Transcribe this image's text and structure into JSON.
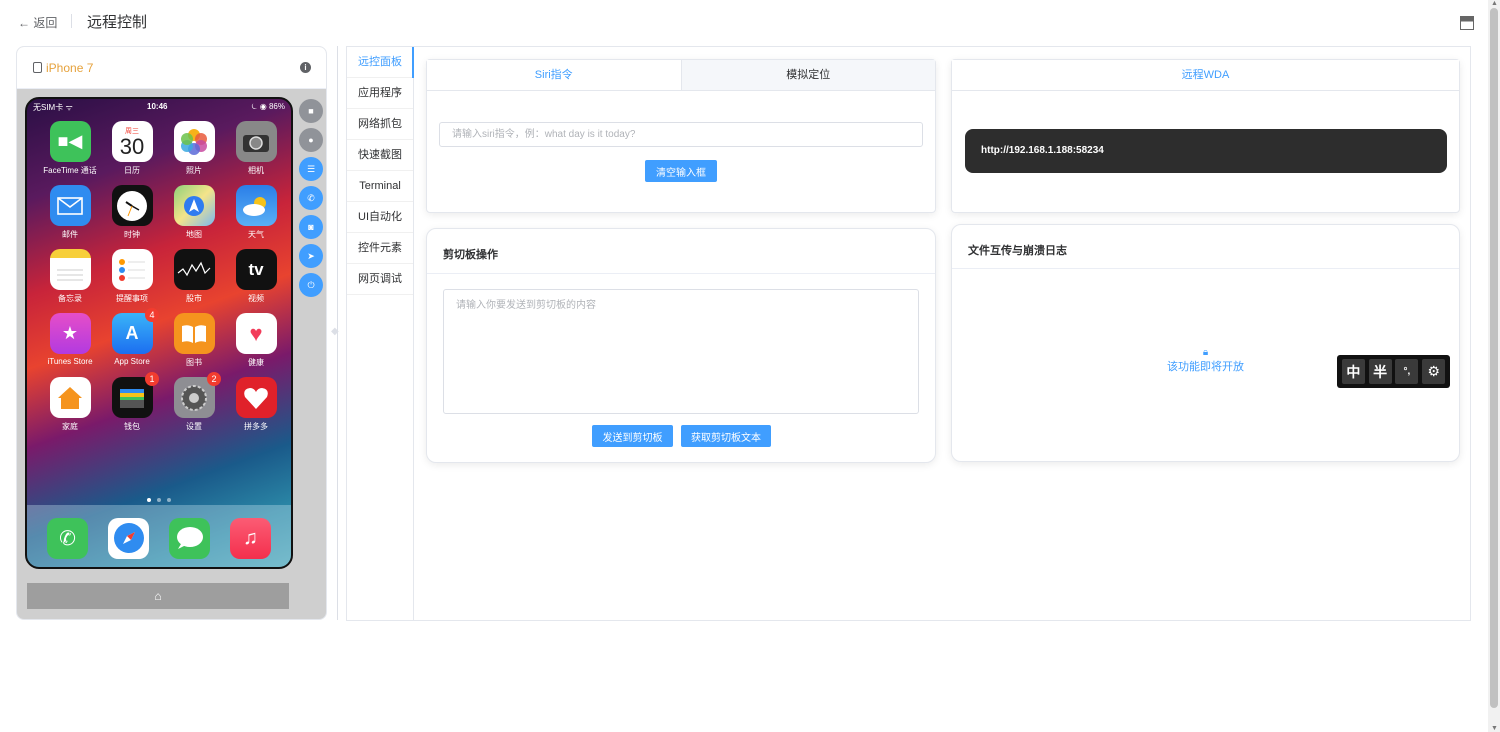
{
  "header": {
    "back_label": "← 返回",
    "title": "远程控制"
  },
  "device": {
    "name": "iPhone 7",
    "status": {
      "carrier": "无SIM卡 ᯤ",
      "time": "10:46",
      "battery": "⏾ ◉ 86%"
    },
    "apps": [
      {
        "label": "FaceTime 通话",
        "icon": "facetime-icon"
      },
      {
        "label": "日历",
        "icon": "calendar-icon",
        "day": "周三",
        "date": "30"
      },
      {
        "label": "照片",
        "icon": "photos-icon"
      },
      {
        "label": "相机",
        "icon": "camera-icon"
      },
      {
        "label": "邮件",
        "icon": "mail-icon"
      },
      {
        "label": "时钟",
        "icon": "clock-icon"
      },
      {
        "label": "地图",
        "icon": "maps-icon"
      },
      {
        "label": "天气",
        "icon": "weather-icon"
      },
      {
        "label": "备忘录",
        "icon": "notes-icon"
      },
      {
        "label": "提醒事项",
        "icon": "reminders-icon"
      },
      {
        "label": "股市",
        "icon": "stocks-icon"
      },
      {
        "label": "视频",
        "icon": "tv-icon",
        "glyph": "tv"
      },
      {
        "label": "iTunes Store",
        "icon": "itunes-icon"
      },
      {
        "label": "App Store",
        "icon": "appstore-icon",
        "badge": "4"
      },
      {
        "label": "图书",
        "icon": "books-icon"
      },
      {
        "label": "健康",
        "icon": "health-icon"
      },
      {
        "label": "家庭",
        "icon": "home-app-icon"
      },
      {
        "label": "钱包",
        "icon": "wallet-icon",
        "badge": "1"
      },
      {
        "label": "设置",
        "icon": "settings-icon",
        "badge": "2"
      },
      {
        "label": "拼多多",
        "icon": "pinduoduo-icon"
      }
    ],
    "dock": [
      "phone-icon",
      "safari-icon",
      "messages-icon",
      "music-icon"
    ],
    "home_glyph": "⌂"
  },
  "vtabs": [
    "远控面板",
    "应用程序",
    "网络抓包",
    "快速截图",
    "Terminal",
    "UI自动化",
    "控件元素",
    "网页调试"
  ],
  "siri": {
    "tabs": [
      "Siri指令",
      "模拟定位"
    ],
    "placeholder": "请输入siri指令，例：what day is it today?",
    "clear_button": "清空输入框"
  },
  "wda": {
    "tab": "远程WDA",
    "url": "http://192.168.1.188:58234"
  },
  "clipboard": {
    "title": "剪切板操作",
    "placeholder": "请输入你要发送到剪切板的内容",
    "send_button": "发送到剪切板",
    "get_button": "获取剪切板文本"
  },
  "files": {
    "title": "文件互传与崩溃日志",
    "coming_soon": "该功能即将开放"
  },
  "ime": [
    "中",
    "半",
    "°,",
    "⚙"
  ],
  "colors": {
    "accent": "#409eff",
    "device_name": "#e6a23c"
  }
}
